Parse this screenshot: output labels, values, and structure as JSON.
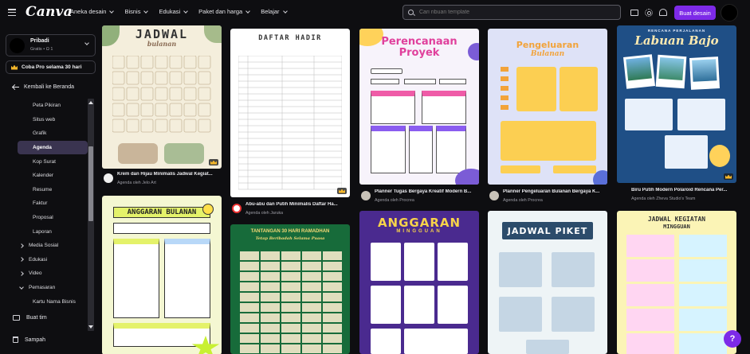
{
  "brand": {
    "logo": "Canva"
  },
  "nav": [
    "Aneka desain",
    "Bisnis",
    "Edukasi",
    "Paket dan harga",
    "Belajar"
  ],
  "search": {
    "placeholder": "Cari ribuan template"
  },
  "header": {
    "create_label": "Buat desain"
  },
  "account": {
    "name": "Pribadi",
    "sub": "Gratis • Ω 1"
  },
  "trial_label": "Coba Pro selama 30 hari",
  "back_label": "Kembali ke Beranda",
  "menu": [
    "Peta Pikiran",
    "Situs web",
    "Grafik",
    "Agenda",
    "Kop Surat",
    "Kalender",
    "Resume",
    "Faktur",
    "Proposal",
    "Laporan"
  ],
  "groups": [
    "Media Sosial",
    "Edukasi",
    "Video",
    "Pemasaran"
  ],
  "sub_item": "Kartu Nama Bisnis",
  "bottom": {
    "team": "Buat tim",
    "trash": "Sampah"
  },
  "colors": {
    "accent": "#7d2ae8",
    "crown": "#f5b72a"
  },
  "cards": [
    {
      "title": "Krem dan Hijau Minimalis Jadwal Kegiat...",
      "author": "Agenda oleh Jelo Art",
      "thumb_title": "JADWAL",
      "thumb_sub": "bulanan"
    },
    {
      "title": "Abu-abu dan Putih Minimalis Daftar Ha...",
      "author": "Agenda oleh Jaruka",
      "thumb_title": "DAFTAR HADIR"
    },
    {
      "title": "Planner Tugas Bergaya Kreatif Modern B...",
      "author": "Agenda oleh Procrea",
      "thumb_title": "Perencanaan Proyek"
    },
    {
      "title": "Planner Pengeluaran Bulanan Bergaya K...",
      "author": "Agenda oleh Procrea",
      "thumb_title": "Pengeluaran",
      "thumb_sub": "Bulanan"
    },
    {
      "title": "Biru Putih Modern Polaroid Rencana Per...",
      "author": "Agenda oleh Zheva Studio's Team",
      "thumb_title": "Labuan Bajo",
      "thumb_sub": "RENCANA PERJALANAN"
    },
    {
      "thumb_title": "ANGGARAN BULANAN"
    },
    {
      "thumb_title": "TANTANGAN 30 HARI RAMADHAN",
      "thumb_sub": "Tetap Beribadah Selama Puasa"
    },
    {
      "thumb_title": "ANGGARAN",
      "thumb_sub": "MINGGUAN"
    },
    {
      "thumb_title": "JADWAL PIKET"
    },
    {
      "thumb_title": "JADWAL KEGIATAN",
      "thumb_sub": "MINGGUAN"
    }
  ]
}
